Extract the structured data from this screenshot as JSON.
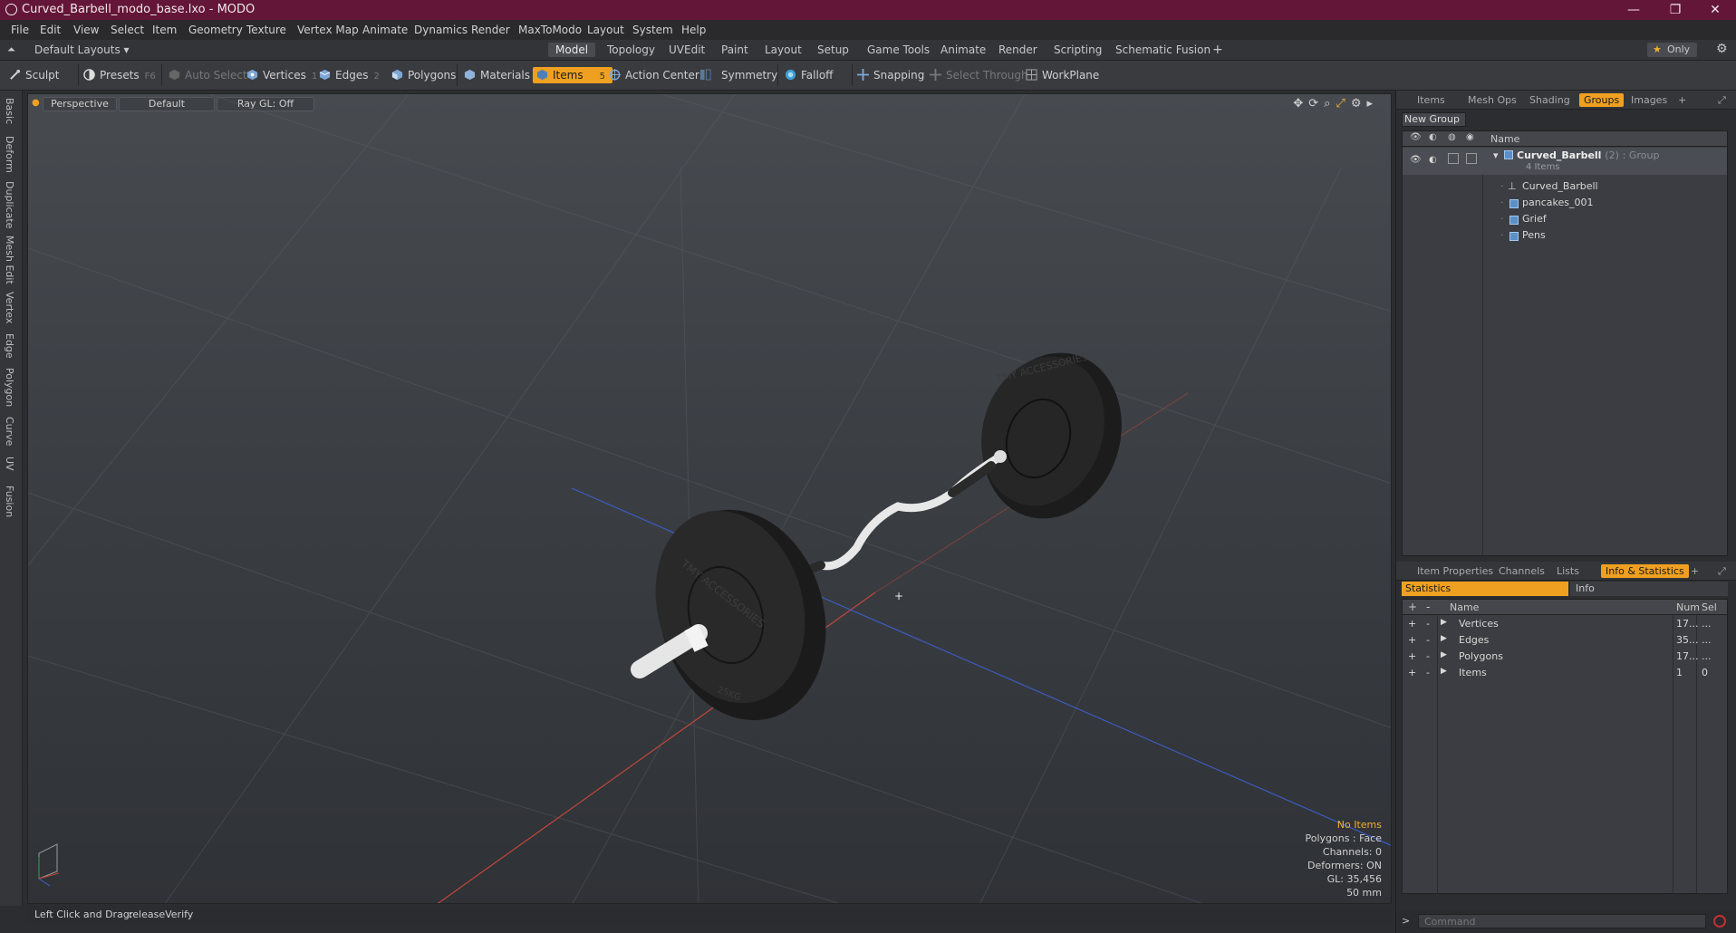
{
  "window": {
    "title": "Curved_Barbell_modo_base.lxo - MODO",
    "minimize": "—",
    "maximize": "❐",
    "close": "✕"
  },
  "menu": [
    "File",
    "Edit",
    "View",
    "Select",
    "Item",
    "Geometry",
    "Texture",
    "Vertex Map",
    "Animate",
    "Dynamics",
    "Render",
    "MaxToModo",
    "Layout",
    "System",
    "Help"
  ],
  "layoutbar": {
    "layouts": "Default Layouts ▾",
    "tabs": [
      "Model",
      "Topology",
      "UVEdit",
      "Paint",
      "Layout",
      "Setup",
      "Game Tools",
      "Animate",
      "Render",
      "Scripting",
      "Schematic Fusion"
    ],
    "add": "+",
    "only": "Only"
  },
  "toolbar": {
    "sculpt": "Sculpt",
    "presets": "Presets",
    "presets_key": "F6",
    "auto_select": "Auto Select",
    "vertices": "Vertices",
    "vertices_key": "1",
    "edges": "Edges",
    "edges_key": "2",
    "polygons": "Polygons",
    "materials": "Materials",
    "items": "Items",
    "items_key": "5",
    "action_center": "Action Center",
    "symmetry": "Symmetry",
    "falloff": "Falloff",
    "snapping": "Snapping",
    "select_through": "Select Through",
    "workplane": "WorkPlane"
  },
  "lefttabs": [
    "Basic",
    "Deform",
    "Duplicate",
    "Mesh Edit",
    "Vertex",
    "Edge",
    "Polygon",
    "Curve",
    "UV",
    "Fusion"
  ],
  "viewport": {
    "view": "Perspective",
    "shading": "Default",
    "raygl": "Ray GL: Off",
    "info": {
      "selection": "No Items",
      "polygons": "Polygons : Face",
      "channels": "Channels: 0",
      "deformers": "Deformers: ON",
      "gl": "GL: 35,456",
      "size": "50 mm"
    },
    "plate_text_front": "TMY ACCESSORIES",
    "plate_text_back": "TMY ACCESSORIES",
    "plate_weight": "25KG"
  },
  "statusbar": {
    "label": "Left Click and Drag:",
    "value": "releaseVerify"
  },
  "groups_panel": {
    "tabs": [
      "Items",
      "Mesh Ops",
      "Shading",
      "Groups",
      "Images"
    ],
    "active": "Groups",
    "new_group": "New Group",
    "col_name": "Name",
    "group": {
      "name": "Curved_Barbell",
      "count": "(2)",
      "type": ": Group",
      "sub": "4 Items"
    },
    "items": [
      "Curved_Barbell",
      "pancakes_001",
      "Grief",
      "Pens"
    ]
  },
  "stats_panel": {
    "tabs": [
      "Item Properties",
      "Channels",
      "Lists",
      "Info & Statistics"
    ],
    "active": "Info & Statistics",
    "subtabs": [
      "Statistics",
      "Info"
    ],
    "headers": {
      "name": "Name",
      "num": "Num",
      "sel": "Sel"
    },
    "rows": [
      {
        "name": "Vertices",
        "num": "17...",
        "sel": "..."
      },
      {
        "name": "Edges",
        "num": "35...",
        "sel": "..."
      },
      {
        "name": "Polygons",
        "num": "17...",
        "sel": "..."
      },
      {
        "name": "Items",
        "num": "1",
        "sel": "0"
      }
    ]
  },
  "command": {
    "prompt": ">",
    "placeholder": "Command"
  }
}
